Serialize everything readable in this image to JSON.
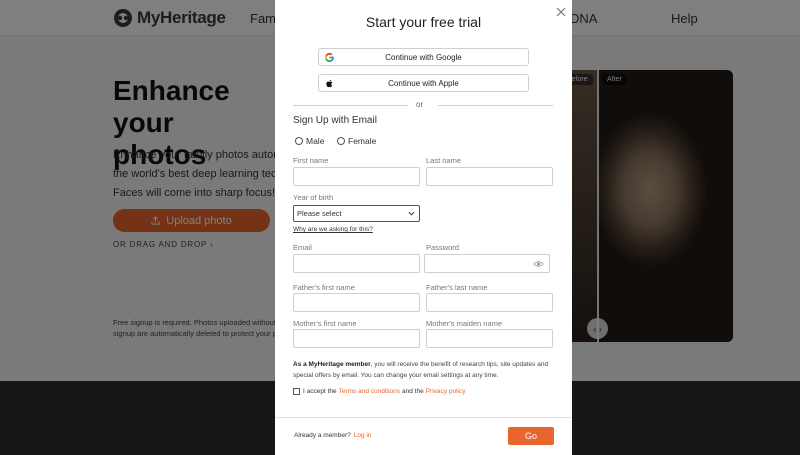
{
  "background": {
    "header": {
      "logo_text": "MyHeritage",
      "nav": [
        "Famil",
        "DNA",
        "Help"
      ]
    },
    "hero": {
      "title": "Enhance your\nphotos",
      "description": "Enhance your family photos automa\nthe world's best deep learning techn\nFaces will come into sharp focus!",
      "upload_label": "Upload photo",
      "drag_drop": "OR DRAG AND DROP",
      "fine_print": "Free signup is required. Photos uploaded without co\nsignup are automatically deleted to protect your priv"
    },
    "photo": {
      "before_label": "Before",
      "after_label": "After"
    }
  },
  "modal": {
    "title": "Start your free trial",
    "google_label": "Continue with Google",
    "apple_label": "Continue with Apple",
    "or_text": "or",
    "section_title": "Sign Up with Email",
    "gender": {
      "male": "Male",
      "female": "Female"
    },
    "fields": {
      "first_name": "First name",
      "last_name": "Last name",
      "year_of_birth": "Year of birth",
      "year_placeholder": "Please select",
      "why_link": "Why are we asking for this?",
      "email": "Email",
      "password": "Password",
      "father_first": "Father's first name",
      "father_last": "Father's last name",
      "mother_first": "Mother's first name",
      "mother_maiden": "Mother's maiden name"
    },
    "info": {
      "bold": "As a MyHeritage member",
      "rest": ", you will receive the benefit of research tips, site updates and special offers by email. You can change your email settings at any time."
    },
    "terms": {
      "prefix": "I accept the",
      "terms_link": "Terms and conditions",
      "and": "and the",
      "privacy_link": "Privacy policy"
    },
    "footer": {
      "already": "Already a member?",
      "login": "Log in",
      "go": "Go"
    }
  },
  "colors": {
    "accent": "#e8662d",
    "footer_bg": "#2c2c2c"
  }
}
